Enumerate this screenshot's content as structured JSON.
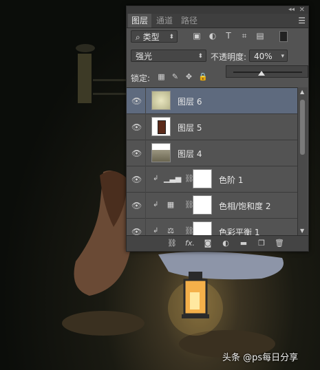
{
  "panel": {
    "tabs": [
      "图层",
      "通道",
      "路径"
    ],
    "collapse_glyph": "◂◂",
    "close_glyph": "✕",
    "menu_glyph": "☰",
    "filter": {
      "kind_label": "类型",
      "search_glyph": "⌕",
      "icons": [
        "image-filter-icon",
        "adjustment-filter-icon",
        "type-filter-icon",
        "shape-filter-icon",
        "smart-object-filter-icon"
      ]
    },
    "blend_mode": "强光",
    "opacity_label": "不透明度:",
    "opacity_value": "40%",
    "opacity_fraction": 0.4,
    "lock_label": "锁定:",
    "lock_icons": [
      "lock-transparent-icon",
      "lock-image-icon",
      "lock-position-icon",
      "lock-all-icon"
    ],
    "layers": [
      {
        "name": "图层 6",
        "type": "pixel",
        "selected": true
      },
      {
        "name": "图层 5",
        "type": "pixel",
        "selected": false
      },
      {
        "name": "图层 4",
        "type": "pixel",
        "selected": false
      },
      {
        "name": "色阶 1",
        "type": "adjustment",
        "selected": false
      },
      {
        "name": "色相/饱和度 2",
        "type": "adjustment",
        "selected": false
      },
      {
        "name": "色彩平衡 1",
        "type": "adjustment",
        "selected": false
      }
    ],
    "bottom_icons": [
      "link-layers-icon",
      "fx-icon",
      "add-mask-icon",
      "new-adjustment-icon",
      "new-group-icon",
      "new-layer-icon",
      "delete-layer-icon"
    ],
    "fx_label": "fx."
  },
  "watermark": "头条 @ps每日分享",
  "colors": {
    "panel_bg": "#535353",
    "selected_row": "#5e6a7e",
    "annotation": "#d02020"
  }
}
